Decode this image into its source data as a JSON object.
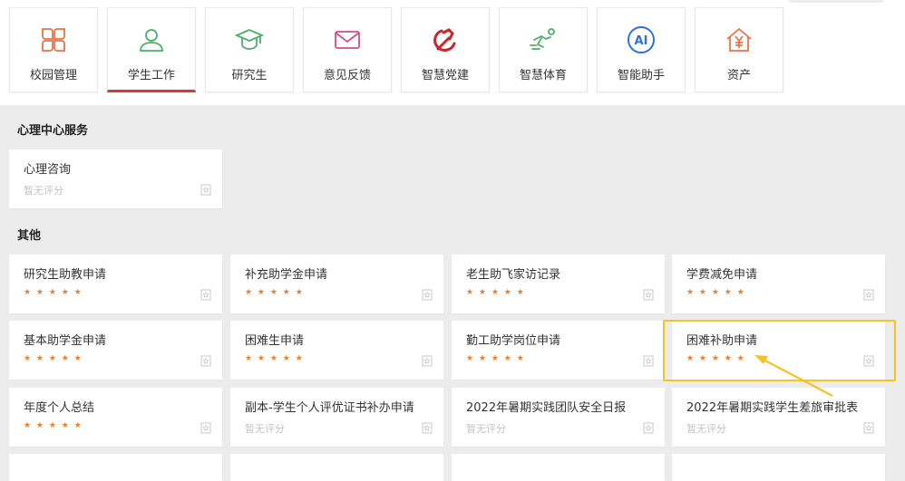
{
  "nav": [
    {
      "label": "校园管理",
      "icon": "grid-apps-icon"
    },
    {
      "label": "学生工作",
      "icon": "user-icon",
      "active": true
    },
    {
      "label": "研究生",
      "icon": "graduation-cap-icon"
    },
    {
      "label": "意见反馈",
      "icon": "envelope-icon"
    },
    {
      "label": "智慧党建",
      "icon": "hammer-sickle-icon"
    },
    {
      "label": "智慧体育",
      "icon": "running-icon"
    },
    {
      "label": "智能助手",
      "icon": "ai-icon"
    },
    {
      "label": "资产",
      "icon": "house-yuan-icon"
    }
  ],
  "sections": {
    "psych": {
      "title": "心理中心服务"
    },
    "other": {
      "title": "其他"
    }
  },
  "cards": {
    "psych": [
      {
        "title": "心理咨询",
        "rating": "暂无评分"
      }
    ],
    "other": [
      {
        "title": "研究生助教申请",
        "stars": "★ ★ ★ ★ ★"
      },
      {
        "title": "补充助学金申请",
        "stars": "★ ★ ★ ★ ★"
      },
      {
        "title": "老生助飞家访记录",
        "stars": "★ ★ ★ ★ ★"
      },
      {
        "title": "学费减免申请",
        "stars": "★ ★ ★ ★ ★"
      },
      {
        "title": "基本助学金申请",
        "stars": "★ ★ ★ ★ ★"
      },
      {
        "title": "困难生申请",
        "stars": "★ ★ ★ ★ ★"
      },
      {
        "title": "勤工助学岗位申请",
        "stars": "★ ★ ★ ★ ★"
      },
      {
        "title": "困难补助申请",
        "stars": "★ ★ ★ ★ ★"
      },
      {
        "title": "年度个人总结",
        "stars": "★ ★ ★ ★ ★"
      },
      {
        "title": "副本-学生个人评优证书补办申请",
        "rating": "暂无评分"
      },
      {
        "title": "2022年暑期实践团队安全日报",
        "rating": "暂无评分"
      },
      {
        "title": "2022年暑期实践学生差旅审批表",
        "rating": "暂无评分"
      }
    ]
  },
  "colors": {
    "accent": "#d9383a",
    "star": "#e8812f",
    "highlight": "#f6c325"
  }
}
